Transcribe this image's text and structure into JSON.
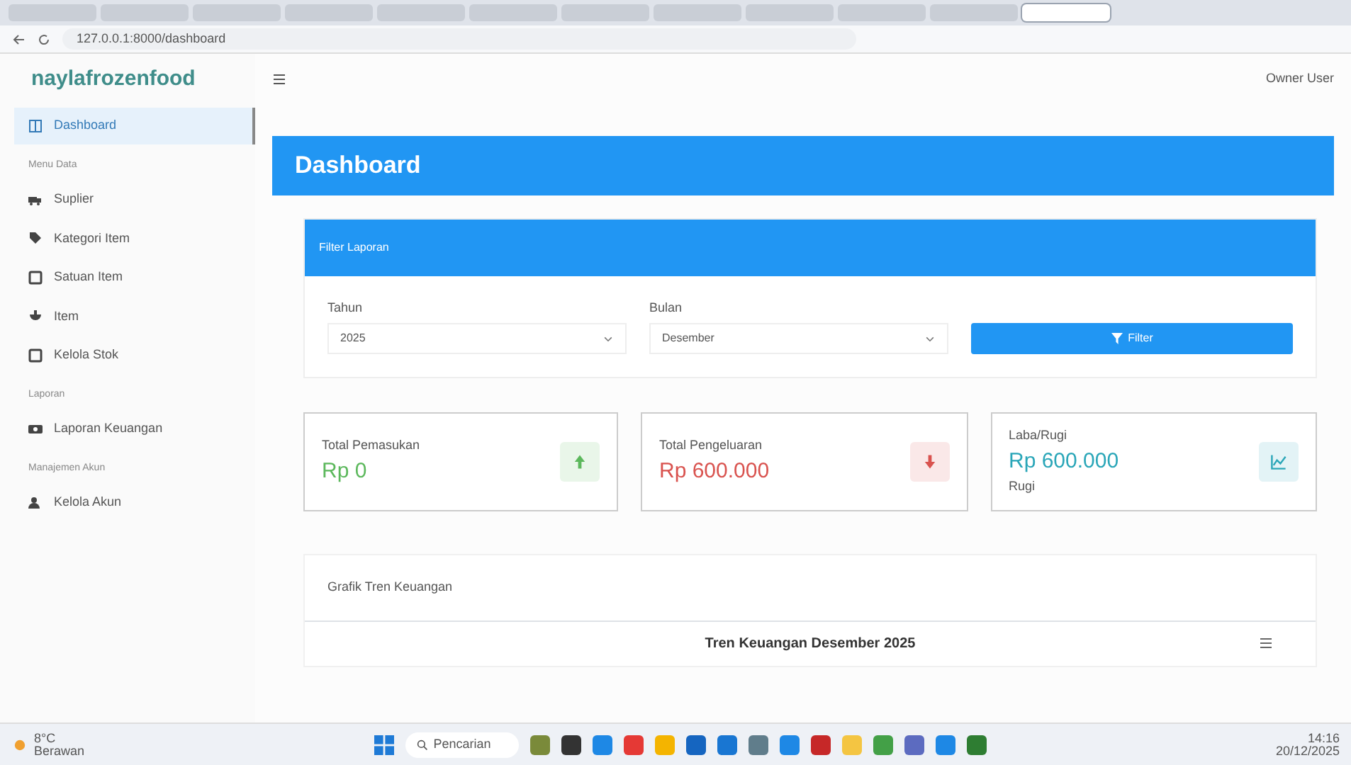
{
  "browser": {
    "tabs": [
      {
        "selected": false
      },
      {
        "selected": false
      },
      {
        "selected": false
      },
      {
        "selected": false
      },
      {
        "selected": false
      },
      {
        "selected": false
      },
      {
        "selected": false
      },
      {
        "selected": false
      },
      {
        "selected": false
      },
      {
        "selected": false
      },
      {
        "selected": false
      },
      {
        "selected": true
      }
    ],
    "address": "127.0.0.1:8000/dashboard"
  },
  "app": {
    "brand": "naylafrozenfood",
    "user": "Owner User"
  },
  "sidebar": {
    "items": [
      {
        "kind": "link",
        "label": "Dashboard",
        "selected": true
      },
      {
        "kind": "heading",
        "label": "Menu Data"
      },
      {
        "kind": "link",
        "label": "Suplier",
        "selected": false
      },
      {
        "kind": "link",
        "label": "Kategori Item",
        "selected": false
      },
      {
        "kind": "link",
        "label": "Satuan Item",
        "selected": false
      },
      {
        "kind": "link",
        "label": "Item",
        "selected": false
      },
      {
        "kind": "link",
        "label": "Kelola Stok",
        "selected": false
      },
      {
        "kind": "heading",
        "label": "Laporan"
      },
      {
        "kind": "link",
        "label": "Laporan Keuangan",
        "selected": false
      },
      {
        "kind": "heading",
        "label": "Manajemen Akun"
      },
      {
        "kind": "link",
        "label": "Kelola Akun",
        "selected": false
      }
    ]
  },
  "page_title": "Dashboard",
  "filter": {
    "title": "Filter Laporan",
    "fields": [
      {
        "label": "Tahun",
        "value": "2025"
      },
      {
        "label": "Bulan",
        "value": "Desember"
      }
    ],
    "button": "Filter"
  },
  "stats": [
    {
      "label": "Total Pemasukan",
      "value": "Rp 0",
      "color": "#5cb85c"
    },
    {
      "label": "Total Pengeluaran",
      "value": "Rp 600.000",
      "color": "#d9534f"
    },
    {
      "label": "Laba/Rugi",
      "value": "Rp 600.000",
      "note": "Rugi",
      "color": "#2aa6b8"
    }
  ],
  "chart_card": {
    "title": "Grafik Tren Keuangan",
    "chart_title": "Tren Keuangan Desember 2025"
  },
  "taskbar": {
    "weather": "8°C",
    "weather_note": "Berawan",
    "search": "Pencarian",
    "time": "14:16",
    "date": "20/12/2025"
  }
}
